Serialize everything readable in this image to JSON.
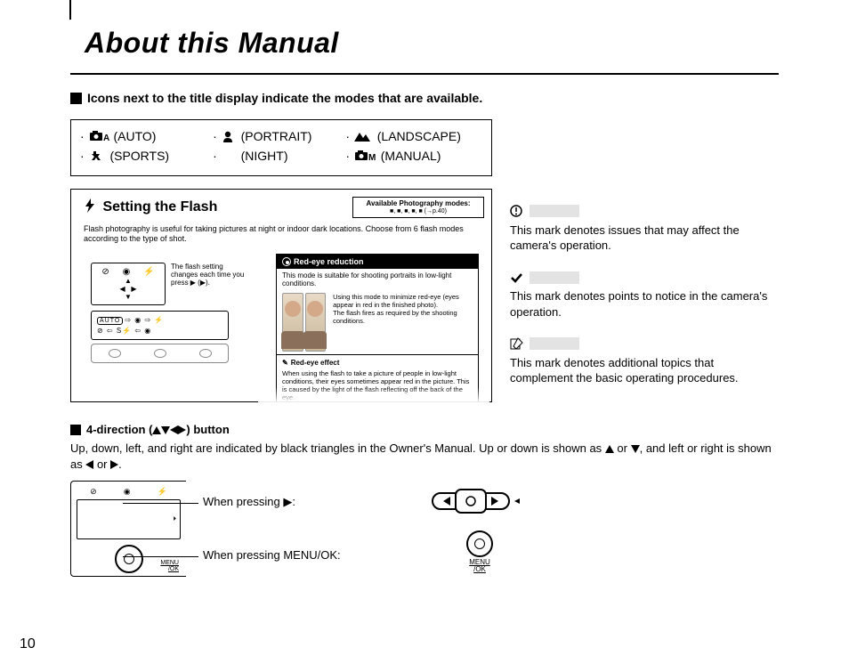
{
  "page_number": "10",
  "title": "About this Manual",
  "intro_line": "Icons next to the title display indicate the modes that are available.",
  "modes": {
    "auto": "(AUTO)",
    "portrait": "(PORTRAIT)",
    "landscape": "(LANDSCAPE)",
    "sports": "(SPORTS)",
    "night": "(NIGHT)",
    "manual": "(MANUAL)"
  },
  "flash": {
    "title": "Setting the Flash",
    "badge_line1": "Available Photography modes:",
    "badge_line2": "■, ■, ■, ■, ■ (→p.40)",
    "desc": "Flash photography is useful for taking pictures at night or indoor dark locations. Choose from 6 flash modes according to the type of shot.",
    "lcd_note": "The flash setting changes each time you press ▶ (▶).",
    "auto_label": "AUTO",
    "redeye_title": "Red-eye reduction",
    "redeye_body": "This mode is suitable for shooting portraits in low-light conditions.",
    "redeye_note": "Using this mode to minimize red-eye (eyes appear in red in the finished photo).\nThe flash fires as required by the shooting conditions.",
    "effect_title": "Red-eye effect",
    "effect_body": "When using the flash to take a picture of people in low-light conditions, their eyes sometimes appear red in the picture. This is caused by the light of the flash reflecting off the back of the eye."
  },
  "notes": {
    "caution": "This mark denotes issues that may affect the camera's operation.",
    "check": "This mark denotes points to notice in the camera's operation.",
    "memo": "This mark denotes additional topics that complement the basic operating procedures."
  },
  "direction": {
    "heading_prefix": "4-direction (",
    "heading_suffix": ") button",
    "body_1": "Up, down, left, and right are indicated by black triangles in the Owner's Manual. Up or down is shown as ",
    "body_2": " or ",
    "body_3": ", and left or right is shown as ",
    "body_4": " or ",
    "body_5": ".",
    "press_right": "When pressing ▶:",
    "press_menu": "When pressing MENU/OK:",
    "menu_label": "MENU",
    "ok_label": "/OK"
  }
}
